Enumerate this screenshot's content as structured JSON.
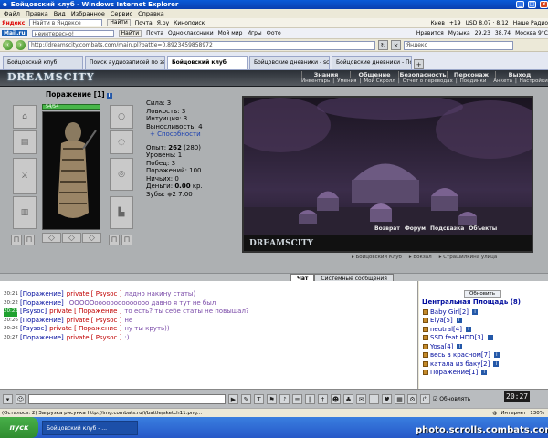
{
  "window": {
    "title": "Бойцовский клуб - Windows Internet Explorer"
  },
  "menu": [
    "Файл",
    "Правка",
    "Вид",
    "Избранное",
    "Сервис",
    "Справка"
  ],
  "yandex_bar": {
    "brand": "Яндекс",
    "search_placeholder": "Найти в Яндексе",
    "items": [
      "Почта",
      "Я.ру",
      "Найти",
      "Кинопоиск"
    ],
    "weather": "Киев",
    "temp": "+19",
    "usd": "USD 8.07 · 8.12",
    "radio": "Наше Радио"
  },
  "mail_bar": {
    "brand": "Mail.ru",
    "search_value": "неинтересно!",
    "find": "Найти",
    "items": [
      "Почта",
      "Одноклассники",
      "Мой мир",
      "Игры",
      "Фото"
    ],
    "right_items": [
      "Нравится",
      "Музыка",
      "29.23",
      "38.74",
      "Москва 9°C"
    ]
  },
  "address_bar": {
    "url": "http://dreamscity.combats.com/main.pl?battle=0.8923459858972",
    "search_placeholder": "Яндекс"
  },
  "tabs": [
    {
      "label": "Бойцовский клуб",
      "active": false
    },
    {
      "label": "Поиск аудиозаписей по запр...",
      "active": false
    },
    {
      "label": "Бойцовский клуб",
      "active": true
    },
    {
      "label": "Бойцовские дневники - sch...",
      "active": false
    },
    {
      "label": "Бойцовские дневники - Пор...",
      "active": false
    }
  ],
  "game": {
    "logo": "DREAMSCITY",
    "top_nav": [
      "Знания",
      "Общение",
      "Безопасность",
      "Персонаж",
      "Выход"
    ],
    "sub_nav": [
      "Инвентарь",
      "Умения",
      "Мой Скролл",
      "Отчет о переводах",
      "Поединки",
      "Анкета",
      "Настройки"
    ],
    "character": {
      "name": "Поражение",
      "level_tag": "[1]",
      "hp": "54/54",
      "stats": [
        {
          "label": "Сила",
          "value": "3"
        },
        {
          "label": "Ловкость",
          "value": "3"
        },
        {
          "label": "Интуиция",
          "value": "3"
        },
        {
          "label": "Выносливость",
          "value": "4"
        }
      ],
      "abilities_link": "+ Способности",
      "experience_label": "Опыт:",
      "experience_value": "262",
      "experience_next": "(280)",
      "level": "Уровень: 1",
      "wins": "Побед: 3",
      "losses": "Поражений: 100",
      "draws": "Ничьих: 0",
      "money_label": "Деньги:",
      "money_value": "0.00",
      "money_unit": "кр.",
      "teeth_label": "Зубы:",
      "teeth_value": "2 7.00"
    },
    "scene_logo": "DREAMSCITY",
    "scene_nav": [
      "Возврат",
      "Форум",
      "Подсказка",
      "Объекты"
    ],
    "below_scene": [
      "Бойцовский Клуб",
      "Вокзал",
      "Страшилкина улица"
    ],
    "colors": {
      "accent": "#6a3e8c",
      "hp": "#49b649",
      "chat_name": "#000c9e",
      "private": "#c00000",
      "chat_text": "#7a4aa8"
    }
  },
  "chat": {
    "tabs": [
      "Чат",
      "Системные сообщения"
    ],
    "messages": [
      {
        "time": "20:21",
        "from": "[Поражение]",
        "kw": "private [ Psysoc ]",
        "text": "ладно накину статы)",
        "hl": false
      },
      {
        "time": "20:22",
        "from": "[Поражение]",
        "kw": "",
        "text": "ОООООоооооооооооооо давно я тут не был",
        "hl": false
      },
      {
        "time": "20:23",
        "from": "[Psysoc]",
        "kw": "private [ Поражение ]",
        "text": "то есть? ты себе статы не повышал?",
        "hl": true
      },
      {
        "time": "20:26",
        "from": "[Поражение]",
        "kw": "private [ Psysoc ]",
        "text": "не",
        "hl": false
      },
      {
        "time": "20:26",
        "from": "[Psysoc]",
        "kw": "private [ Поражение ]",
        "text": "ну ты круть))",
        "hl": false
      },
      {
        "time": "20:27",
        "from": "[Поражение]",
        "kw": "private [ Psysoc ]",
        "text": ":)",
        "hl": false
      }
    ],
    "refresh": "Обновить",
    "room": "Центральная Площадь (8)",
    "users": [
      "Baby Girl[2]",
      "Elya[5]",
      "neutral[4]",
      "SSD feat HDD[3]",
      "Yosa[4]",
      "весь в красном[7]",
      "катала из баку[2]",
      "Поражение[1]"
    ],
    "clock": "20:27",
    "toolbar_label": "Обновлять"
  },
  "status": {
    "text": "(Осталось: 2) Загрузка рисунка http://img.combats.ru/i/battle/sketch11.png...",
    "zone": "Интернет",
    "zoom": "130%"
  },
  "taskbar": {
    "start": "пуск",
    "item": "Бойцовский клуб - ...",
    "watermark": "photo.scrolls.combats.com"
  }
}
